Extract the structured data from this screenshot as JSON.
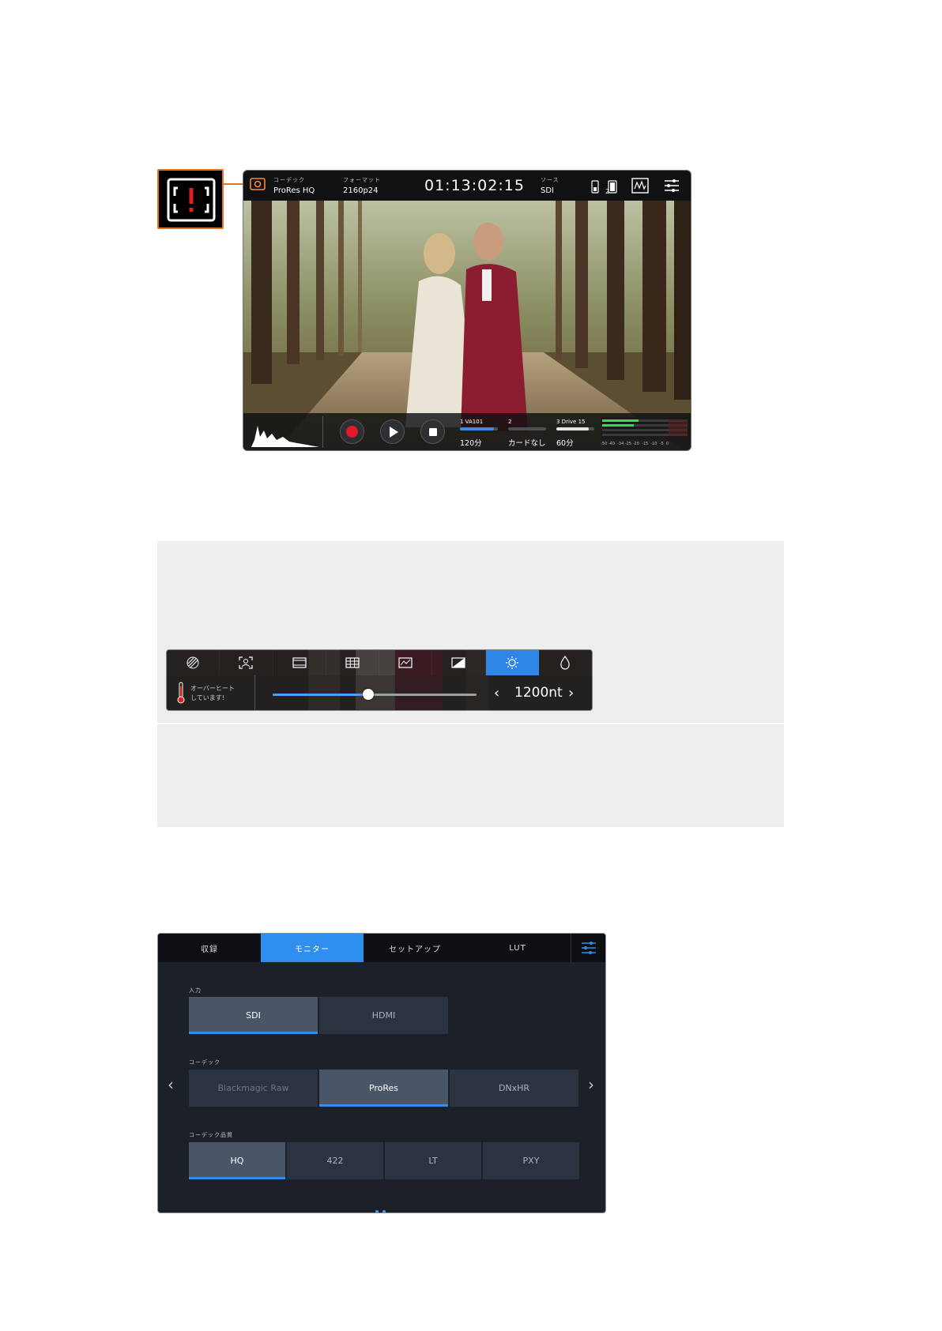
{
  "monitor": {
    "codec_label": "コーデック",
    "codec_value": "ProRes HQ",
    "format_label": "フォーマット",
    "format_value": "2160p24",
    "timecode": "01:13:02:15",
    "source_label": "ソース",
    "source_value": "SDI",
    "battery_number": "2",
    "slots": [
      {
        "label": "1  VA101",
        "value": "120分",
        "fill": 0.9,
        "color": "#3a8fe8"
      },
      {
        "label": "2",
        "value": "カードなし",
        "fill": 0,
        "color": "#3a8fe8"
      },
      {
        "label": "3  Drive 15",
        "value": "60分",
        "fill": 0.85,
        "color": "#e6e6e6"
      }
    ],
    "audio_scale": "-50 -40  -34 -25 -20  -15  -10  -5  0"
  },
  "brightness": {
    "tabs": [
      "zebra",
      "focus-assist",
      "frame-guides",
      "grid",
      "false-color",
      "contrast",
      "brightness",
      "saturation"
    ],
    "active_tab": 6,
    "warning_line1": "オーバーヒート",
    "warning_line2": "しています!",
    "value": "1200nt",
    "level": 0.47
  },
  "menu": {
    "tabs": [
      "収録",
      "モニター",
      "セットアップ",
      "LUT"
    ],
    "active_tab": 1,
    "input_label": "入力",
    "input_options": [
      "SDI",
      "HDMI"
    ],
    "input_selected": 0,
    "codec_label": "コーデック",
    "codec_options": [
      "Blackmagic Raw",
      "ProRes",
      "DNxHR"
    ],
    "codec_selected": 1,
    "quality_label": "コーデック品質",
    "quality_options": [
      "HQ",
      "422",
      "LT",
      "PXY"
    ],
    "quality_selected": 0,
    "accent": "#2f8ff0"
  }
}
